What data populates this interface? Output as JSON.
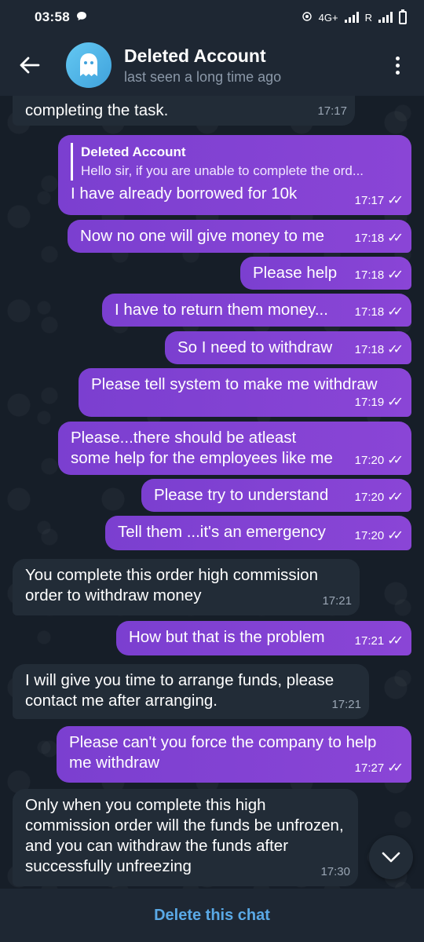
{
  "status_bar": {
    "time": "03:58",
    "network_label": "4G+",
    "roaming_label": "R"
  },
  "header": {
    "title": "Deleted Account",
    "subtitle": "last seen a long time ago"
  },
  "messages": [
    {
      "dir": "in",
      "text": "completing the task.",
      "time": "17:17"
    },
    {
      "dir": "out",
      "reply_name": "Deleted Account",
      "reply_text": "Hello sir, if you are unable to complete the ord...",
      "text": "I have already borrowed for 10k",
      "time": "17:17"
    },
    {
      "dir": "out",
      "text": "Now no one will give money to me",
      "time": "17:18"
    },
    {
      "dir": "out",
      "text": "Please help",
      "time": "17:18"
    },
    {
      "dir": "out",
      "text": "I have to return them money...",
      "time": "17:18"
    },
    {
      "dir": "out",
      "text": "So I need to withdraw",
      "time": "17:18"
    },
    {
      "dir": "out",
      "text": "Please tell system to make me withdraw",
      "time": "17:19"
    },
    {
      "dir": "out",
      "text": "Please...there should be atleast some help for the employees like me",
      "time": "17:20"
    },
    {
      "dir": "out",
      "text": "Please try to understand",
      "time": "17:20"
    },
    {
      "dir": "out",
      "text": "Tell them ...it's an emergency",
      "time": "17:20"
    },
    {
      "dir": "in",
      "text": "You complete this order high commission order to withdraw money",
      "time": "17:21"
    },
    {
      "dir": "out",
      "text": "How but that is the problem",
      "time": "17:21"
    },
    {
      "dir": "in",
      "text": "I will give you time to arrange funds, please contact me after arranging.",
      "time": "17:21"
    },
    {
      "dir": "out",
      "text": "Please can't you force the company to help me withdraw",
      "time": "17:27"
    },
    {
      "dir": "in",
      "text": "Only when you complete this high commission order will the funds be unfrozen, and you can withdraw the funds after successfully unfreezing",
      "time": "17:30"
    }
  ],
  "footer": {
    "delete_label": "Delete this chat"
  },
  "icons": {
    "back": "arrow-left-icon",
    "avatar": "ghost-icon",
    "menu": "more-vertical-icon",
    "scroll_down": "chevron-down-icon",
    "read": "double-check-icon"
  },
  "colors": {
    "outgoing_bubble": "#8a45d6",
    "incoming_bubble": "#222c37",
    "header_bg": "#1e2733",
    "link": "#5aa9e6"
  }
}
